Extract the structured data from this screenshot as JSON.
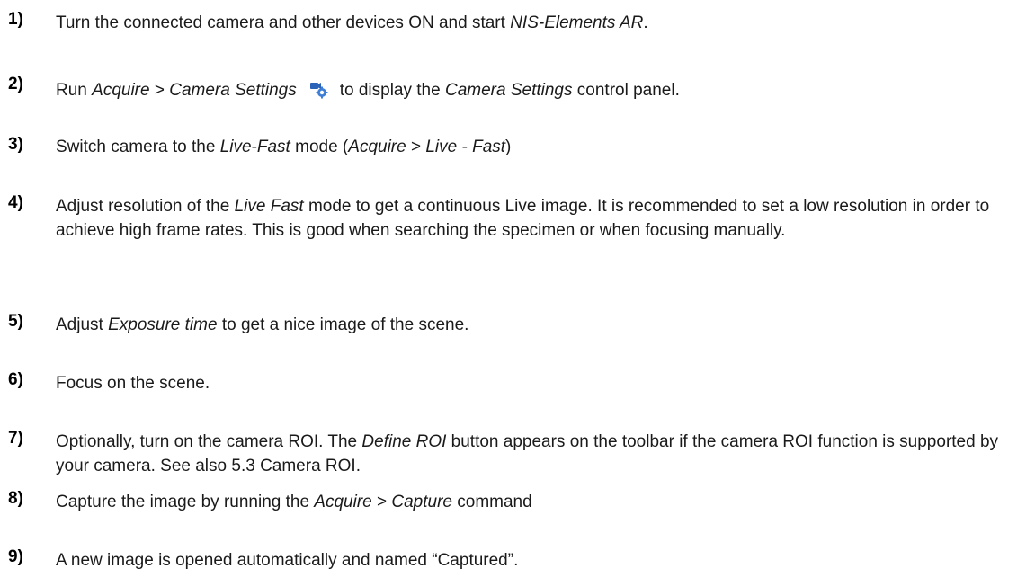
{
  "steps": [
    {
      "number": "1)",
      "parts": [
        {
          "t": "Turn the connected camera and other devices ON and start "
        },
        {
          "t": "NIS-Elements AR",
          "i": true
        },
        {
          "t": "."
        }
      ]
    },
    {
      "number": "2)",
      "parts": [
        {
          "t": "Run "
        },
        {
          "t": "Acquire",
          "i": true
        },
        {
          "t": " > "
        },
        {
          "t": "Camera Settings",
          "i": true
        },
        {
          "icon": "camera-settings-icon"
        },
        {
          "t": "to display the "
        },
        {
          "t": "Camera Settings",
          "i": true
        },
        {
          "t": " control panel."
        }
      ]
    },
    {
      "number": "3)",
      "parts": [
        {
          "t": "Switch camera to the "
        },
        {
          "t": "Live-Fast",
          "i": true
        },
        {
          "t": " mode ("
        },
        {
          "t": "Acquire",
          "i": true
        },
        {
          "t": " > "
        },
        {
          "t": "Live - Fast",
          "i": true
        },
        {
          "t": ")"
        }
      ]
    },
    {
      "number": "4)",
      "parts": [
        {
          "t": "Adjust resolution of the "
        },
        {
          "t": "Live Fast",
          "i": true
        },
        {
          "t": " mode to get a continuous Live image. It is recommended to set a low resolution in order to achieve high frame rates. This is good when searching the specimen or when focusing manually."
        }
      ]
    },
    {
      "number": "5)",
      "parts": [
        {
          "t": "Adjust "
        },
        {
          "t": "Exposure time",
          "i": true
        },
        {
          "t": " to get a nice image of the scene."
        }
      ]
    },
    {
      "number": "6)",
      "parts": [
        {
          "t": "Focus on the scene."
        }
      ]
    },
    {
      "number": "7)",
      "parts": [
        {
          "t": "Optionally, turn on the camera ROI. The "
        },
        {
          "t": "Define ROI",
          "i": true
        },
        {
          "t": " button appears on the toolbar if the camera ROI function is supported by your camera. See also 5.3 Camera ROI."
        }
      ]
    },
    {
      "number": "8)",
      "parts": [
        {
          "t": "Capture the image by running the "
        },
        {
          "t": "Acquire",
          "i": true
        },
        {
          "t": " > "
        },
        {
          "t": "Capture",
          "i": true
        },
        {
          "t": " command"
        }
      ]
    },
    {
      "number": "9)",
      "parts": [
        {
          "t": "A new image is opened automatically and named “Captured”."
        }
      ]
    }
  ]
}
